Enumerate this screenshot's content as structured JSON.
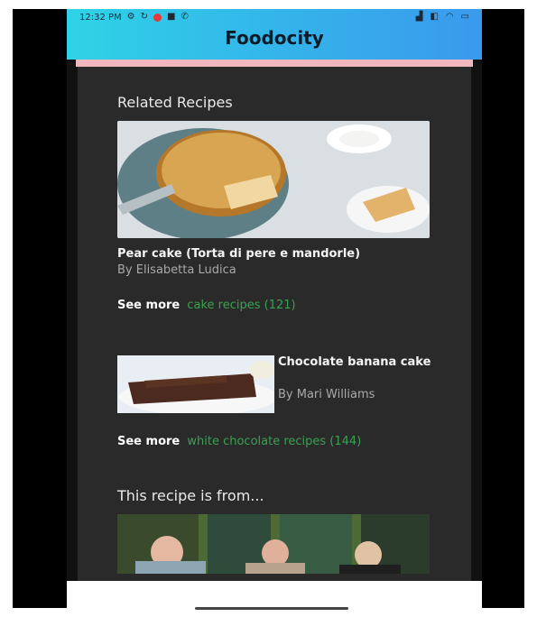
{
  "statusbar": {
    "time": "12:32 PM",
    "left_icons": [
      "settings-icon",
      "sync-icon",
      "record-icon",
      "video-icon",
      "call-icon"
    ],
    "right_icons": [
      "signal-icon",
      "volte-icon",
      "wifi-icon",
      "battery-icon"
    ]
  },
  "appbar": {
    "title": "Foodocity"
  },
  "related": {
    "heading": "Related Recipes",
    "items": [
      {
        "title": "Pear cake (Torta di pere e mandorle)",
        "author": "By Elisabetta Ludica",
        "see_more_label": "See more",
        "see_more_link": "cake recipes (121)"
      },
      {
        "title": "Chocolate banana cake",
        "author": "By Mari Williams",
        "see_more_label": "See more",
        "see_more_link": "white chocolate recipes (144)"
      }
    ]
  },
  "source": {
    "heading": "This recipe is from..."
  },
  "colors": {
    "appbar_start": "#2fd3e6",
    "appbar_end": "#3a99ec",
    "content_bg": "#2a2a2a",
    "link_green": "#3aa152",
    "accent_strip": "#f0b7be"
  }
}
